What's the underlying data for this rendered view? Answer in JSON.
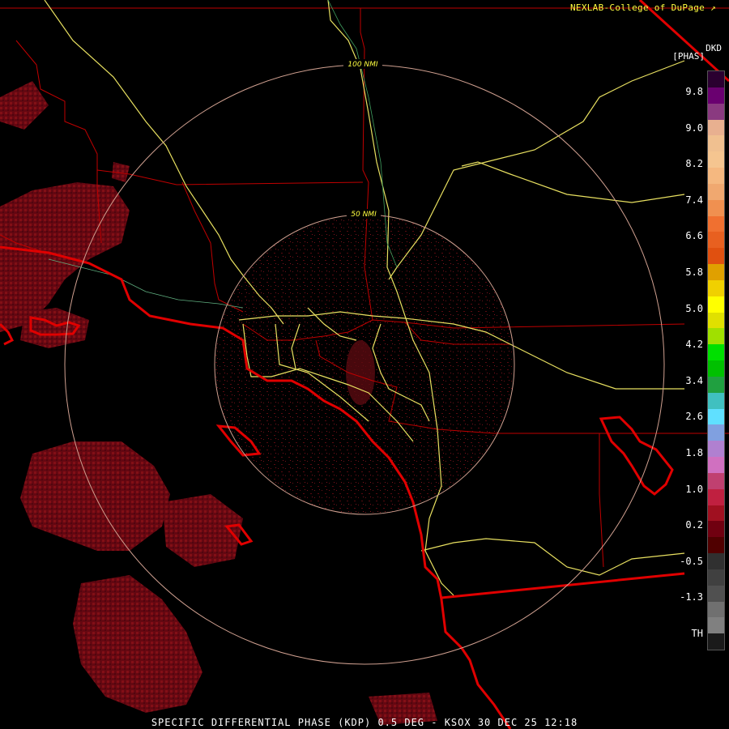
{
  "credit": "NEXLAB-College of DuPage",
  "product": {
    "code": "DKD",
    "unit": "[PHAS]"
  },
  "caption": "SPECIFIC DIFFERENTIAL PHASE (KDP) 0.5 DEG - KSOX 30 DEC 25 12:18",
  "range_rings": [
    {
      "label": "100 NMI"
    },
    {
      "label": "50 NMI"
    }
  ],
  "scale": {
    "tick_labels": [
      "9.8",
      "9.0",
      "8.2",
      "7.4",
      "6.6",
      "5.8",
      "5.0",
      "4.2",
      "3.4",
      "2.6",
      "1.8",
      "1.0",
      "0.2",
      "-0.5",
      "-1.3",
      "TH"
    ],
    "colors": [
      "#2a0030",
      "#6a0070",
      "#8a3a80",
      "#e8b090",
      "#f0c090",
      "#f5c590",
      "#f5b880",
      "#f0a870",
      "#f09050",
      "#f07030",
      "#e86020",
      "#e05010",
      "#e0a000",
      "#f0d000",
      "#ffff00",
      "#e0e000",
      "#a0e000",
      "#00e000",
      "#00c000",
      "#20a040",
      "#40c0c0",
      "#60e0ff",
      "#80a0e0",
      "#b080d0",
      "#d070c0",
      "#c04070",
      "#c02040",
      "#a01020",
      "#700010",
      "#500000",
      "#303030",
      "#404040",
      "#505050",
      "#707070",
      "#808080",
      "#1a1a1a"
    ]
  },
  "colors": {
    "ring": "#d0a090",
    "highway": "#e8e060",
    "county": "#c00000",
    "coast": "#e00000",
    "echo": "#7a0a14",
    "credit": "#ffff40"
  },
  "icons": [
    "external-link-icon"
  ]
}
